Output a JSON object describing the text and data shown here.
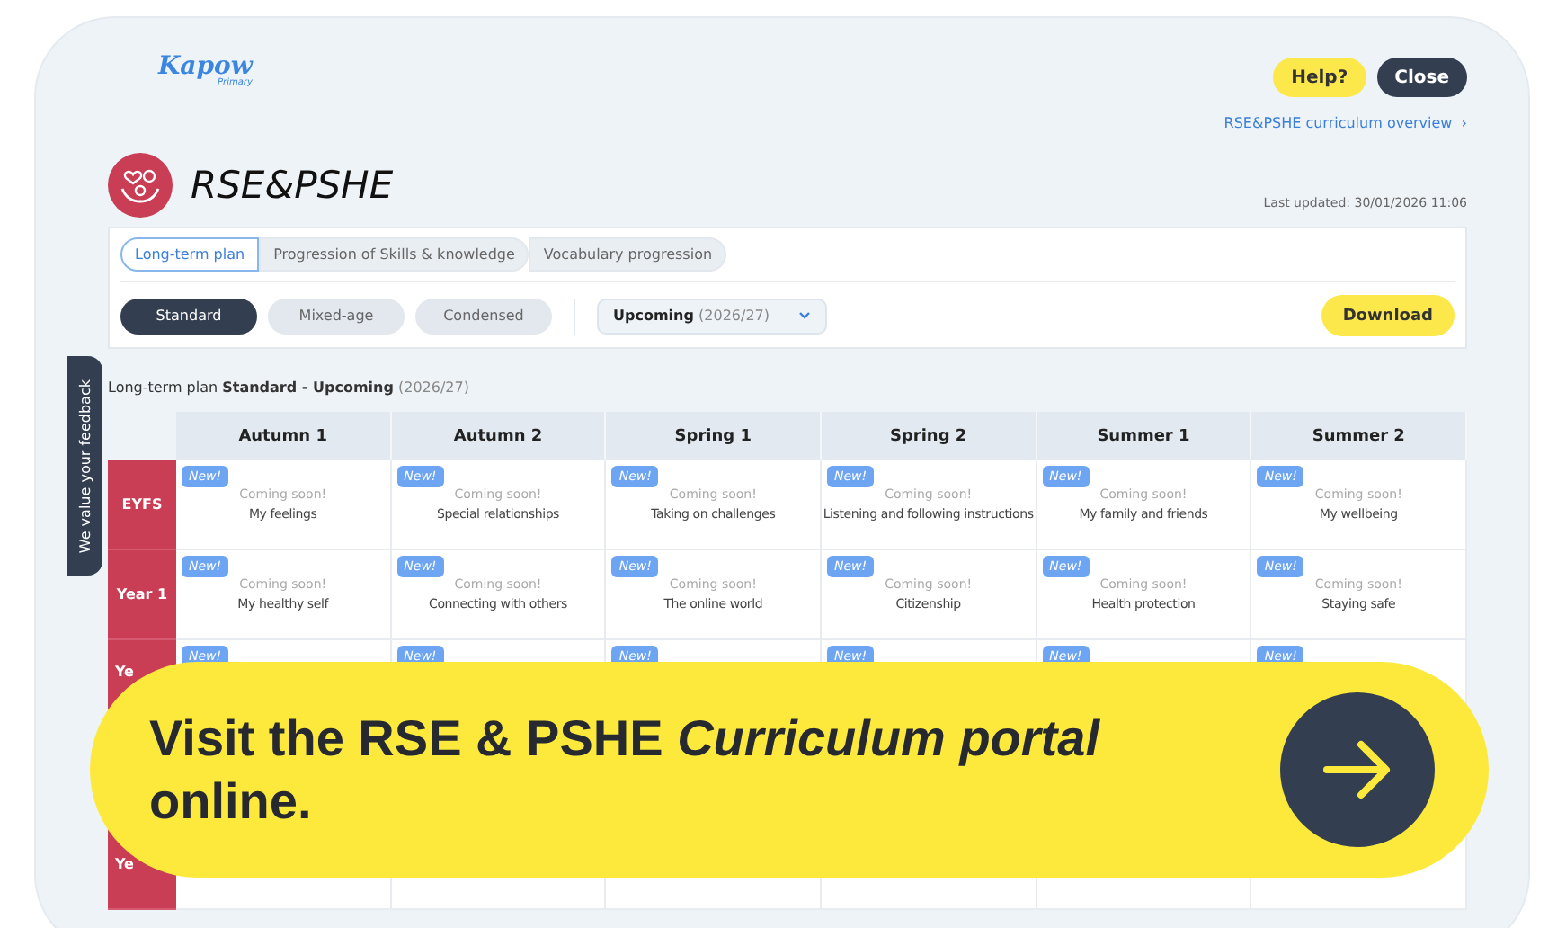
{
  "header": {
    "logo": "Kapow",
    "logo_sub": "Primary",
    "buttons": [
      {
        "label": "Help?",
        "kind": "help"
      },
      {
        "label": "Close",
        "kind": "close"
      }
    ],
    "overview_link": "RSE&PSHE curriculum overview",
    "overview_chevron": "›"
  },
  "subject": {
    "title": "RSE&PSHE",
    "last_updated": "Last updated: 30/01/2026 11:06"
  },
  "tabs": [
    {
      "label": "Long-term plan",
      "selected": true
    },
    {
      "label": "Progression of Skills & knowledge",
      "selected": false
    },
    {
      "label": "Vocabulary progression",
      "selected": false
    }
  ],
  "plan_types": [
    {
      "label": "Standard",
      "selected": true
    },
    {
      "label": "Mixed-age",
      "selected": false
    },
    {
      "label": "Condensed",
      "selected": false
    }
  ],
  "year_select": {
    "value": "Upcoming",
    "detail": "(2026/27)"
  },
  "download": "Download",
  "caption": {
    "prefix": "Long-term plan",
    "bold": "Standard - Upcoming",
    "detail": "(2026/27)"
  },
  "feedback_tab": "We value your feedback",
  "table": {
    "columns": [
      "Autumn 1",
      "Autumn 2",
      "Spring 1",
      "Spring 2",
      "Summer 1",
      "Summer 2"
    ],
    "rows": [
      {
        "label": "EYFS",
        "cells": [
          {
            "badge": "New!",
            "status": "Coming soon!",
            "title": "My feelings"
          },
          {
            "badge": "New!",
            "status": "Coming soon!",
            "title": "Special relationships"
          },
          {
            "badge": "New!",
            "status": "Coming soon!",
            "title": "Taking on challenges"
          },
          {
            "badge": "New!",
            "status": "Coming soon!",
            "title": "Listening and following instructions"
          },
          {
            "badge": "New!",
            "status": "Coming soon!",
            "title": "My family and friends"
          },
          {
            "badge": "New!",
            "status": "Coming soon!",
            "title": "My wellbeing"
          }
        ]
      },
      {
        "label": "Year 1",
        "cells": [
          {
            "badge": "New!",
            "status": "Coming soon!",
            "title": "My healthy self"
          },
          {
            "badge": "New!",
            "status": "Coming soon!",
            "title": "Connecting with others"
          },
          {
            "badge": "New!",
            "status": "Coming soon!",
            "title": "The online world"
          },
          {
            "badge": "New!",
            "status": "Coming soon!",
            "title": "Citizenship"
          },
          {
            "badge": "New!",
            "status": "Coming soon!",
            "title": "Health protection"
          },
          {
            "badge": "New!",
            "status": "Coming soon!",
            "title": "Staying safe"
          }
        ]
      },
      {
        "label": "Ye",
        "cells": [
          {
            "badge": "New!"
          },
          {
            "badge": "New!"
          },
          {
            "badge": "New!"
          },
          {
            "badge": "New!"
          },
          {
            "badge": "New!"
          },
          {
            "badge": "New!"
          }
        ]
      },
      {
        "label": "Ye",
        "cells": [
          {},
          {},
          {},
          {},
          {},
          {}
        ]
      }
    ]
  },
  "banner": {
    "text": "Visit the RSE & PSHE *Curriculum portal* online."
  }
}
